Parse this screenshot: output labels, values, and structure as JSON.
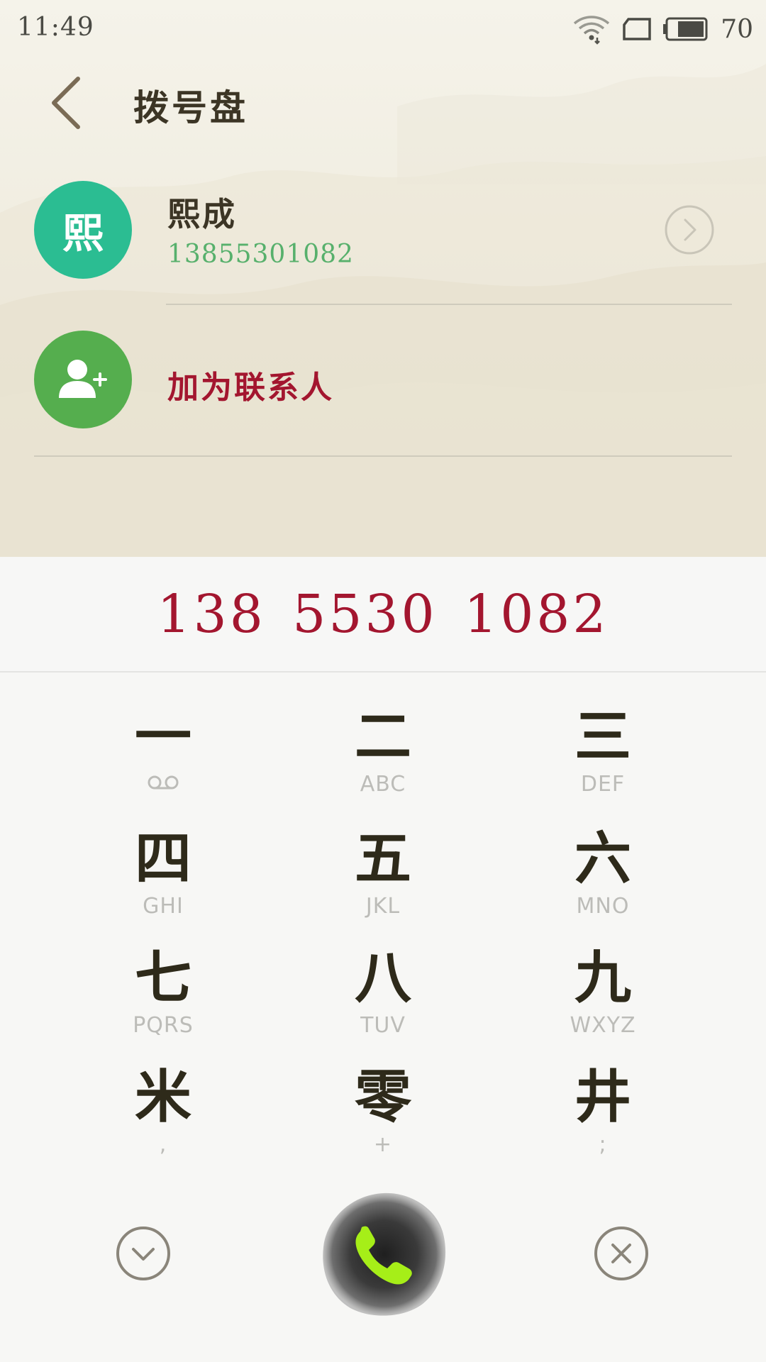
{
  "status_bar": {
    "time": "11:49",
    "battery_level": "70",
    "icons": [
      "wifi-icon",
      "sim-card-icon",
      "battery-icon"
    ]
  },
  "header": {
    "title": "拨号盘",
    "back_icon": "back-chevron-icon"
  },
  "contact": {
    "avatar_text": "熙",
    "avatar_color": "#2bbd92",
    "name": "熙成",
    "number": "13855301082",
    "detail_icon": "chevron-right-circle-icon"
  },
  "add_contact": {
    "label": "加为联系人",
    "icon": "add-person-icon",
    "avatar_color": "#55ae4e"
  },
  "dialed_number": "138 5530 1082",
  "keypad": [
    {
      "digit": "一",
      "letters": "",
      "sub_icon": "voicemail-icon"
    },
    {
      "digit": "二",
      "letters": "ABC"
    },
    {
      "digit": "三",
      "letters": "DEF"
    },
    {
      "digit": "四",
      "letters": "GHI"
    },
    {
      "digit": "五",
      "letters": "JKL"
    },
    {
      "digit": "六",
      "letters": "MNO"
    },
    {
      "digit": "七",
      "letters": "PQRS"
    },
    {
      "digit": "八",
      "letters": "TUV"
    },
    {
      "digit": "九",
      "letters": "WXYZ"
    },
    {
      "digit": "米",
      "letters": ","
    },
    {
      "digit": "零",
      "letters": "+"
    },
    {
      "digit": "井",
      "letters": ";"
    }
  ],
  "bottom_bar": {
    "collapse_icon": "chevron-down-circle-icon",
    "call_icon": "phone-icon",
    "clear_icon": "close-circle-icon"
  },
  "colors": {
    "accent_red": "#a3162f",
    "number_green": "#57b06c",
    "call_icon_green": "#a6ee18",
    "ink": "#2e2a1a"
  }
}
